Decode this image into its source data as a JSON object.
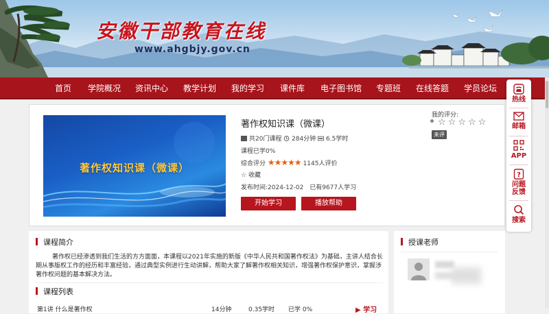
{
  "site": {
    "title": "安徽干部教育在线",
    "url": "www.ahgbjy.gov.cn"
  },
  "nav": [
    "首页",
    "学院概况",
    "资讯中心",
    "教学计划",
    "我的学习",
    "课件库",
    "电子图书馆",
    "专题班",
    "在线答题",
    "学员论坛"
  ],
  "tools": [
    "热线",
    "邮箱",
    "APP",
    "问题反馈",
    "搜索"
  ],
  "course": {
    "title": "著作权知识课（微课）",
    "poster_title": "著作权知识课（微课）",
    "total_label": "共20门课程",
    "duration": "284分钟",
    "hours": "6.5学时",
    "progress": "课程已学0%",
    "rating_label": "综合评分",
    "stars": 5,
    "rating_count": "1145人评价",
    "favorite": "收藏",
    "published": "发布时间:2024-12-02",
    "learners": "已有9677人学习",
    "start_btn": "开始学习",
    "help_btn": "播放帮助",
    "my_rating_label": "我的评分:",
    "unrated": "未评"
  },
  "intro": {
    "heading": "课程简介",
    "text": "著作权已经渗透到我们生活的方方面面，本课程以2021年实施的新版《中华人民共和国著作权法》为基础，主讲人结合长期从事版权工作的经历和丰富经验，通过典型实例进行生动讲解，帮助大家了解著作权相关知识，增强著作权保护意识，掌握涉著作权问题的基本解决方法。",
    "list_heading": "课程列表",
    "first_row": {
      "name": "第1讲 什么是著作权",
      "minutes": "14分钟",
      "hours": "0.35学时",
      "status": "已学 0%",
      "action": "学习"
    }
  },
  "teacher": {
    "heading": "授课老师"
  }
}
